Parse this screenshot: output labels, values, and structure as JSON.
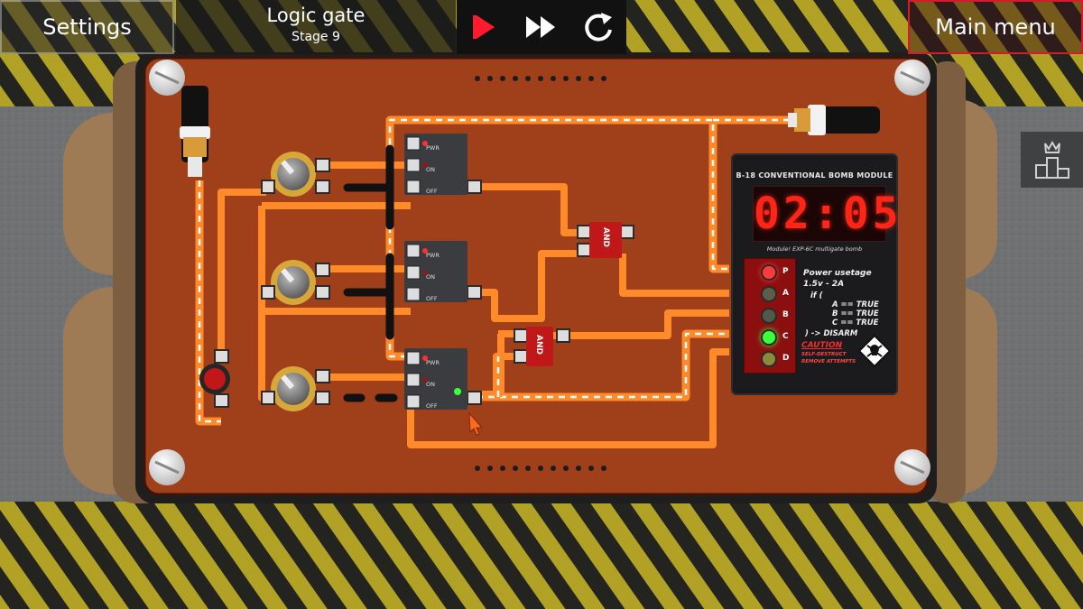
{
  "hud": {
    "settings_label": "Settings",
    "main_menu_label": "Main menu",
    "title": "Logic gate",
    "stage": "Stage 9",
    "controls": [
      "play-icon",
      "fast-forward-icon",
      "restart-icon"
    ]
  },
  "side": {
    "ranking_icon": "ranking-podium-icon"
  },
  "gates": {
    "pins": [
      "PWR",
      "ON",
      "OFF"
    ],
    "and_label": "AND"
  },
  "module": {
    "title": "B-18 CONVENTIONAL BOMB MODULE",
    "timer": "02:05",
    "subtitle": "Module! EXP-6C multigate bomb",
    "lamps": [
      {
        "label": "P",
        "state": "red"
      },
      {
        "label": "A",
        "state": "off"
      },
      {
        "label": "B",
        "state": "off"
      },
      {
        "label": "C",
        "state": "green"
      },
      {
        "label": "D",
        "state": "off"
      }
    ],
    "power_line1": "Power usetage",
    "power_line2": "1.5v - 2A",
    "if_label": "if (",
    "cond_a": "A == TRUE",
    "cond_b": "B == TRUE",
    "cond_c": "C == TRUE",
    "disarm": ") -> DISARM",
    "caution": "CAUTION",
    "caution_sub1": "SELF-DESTRUCT",
    "caution_sub2": "REMOVE ATTEMPTS",
    "hazard_icon": "skull-hazard-icon"
  },
  "colors": {
    "board": "#a0401a",
    "wire": "#ff8a2a",
    "wire_active": "#ffffff",
    "hazard_yellow": "#c8b41a",
    "accent_red": "#d21c2c"
  }
}
